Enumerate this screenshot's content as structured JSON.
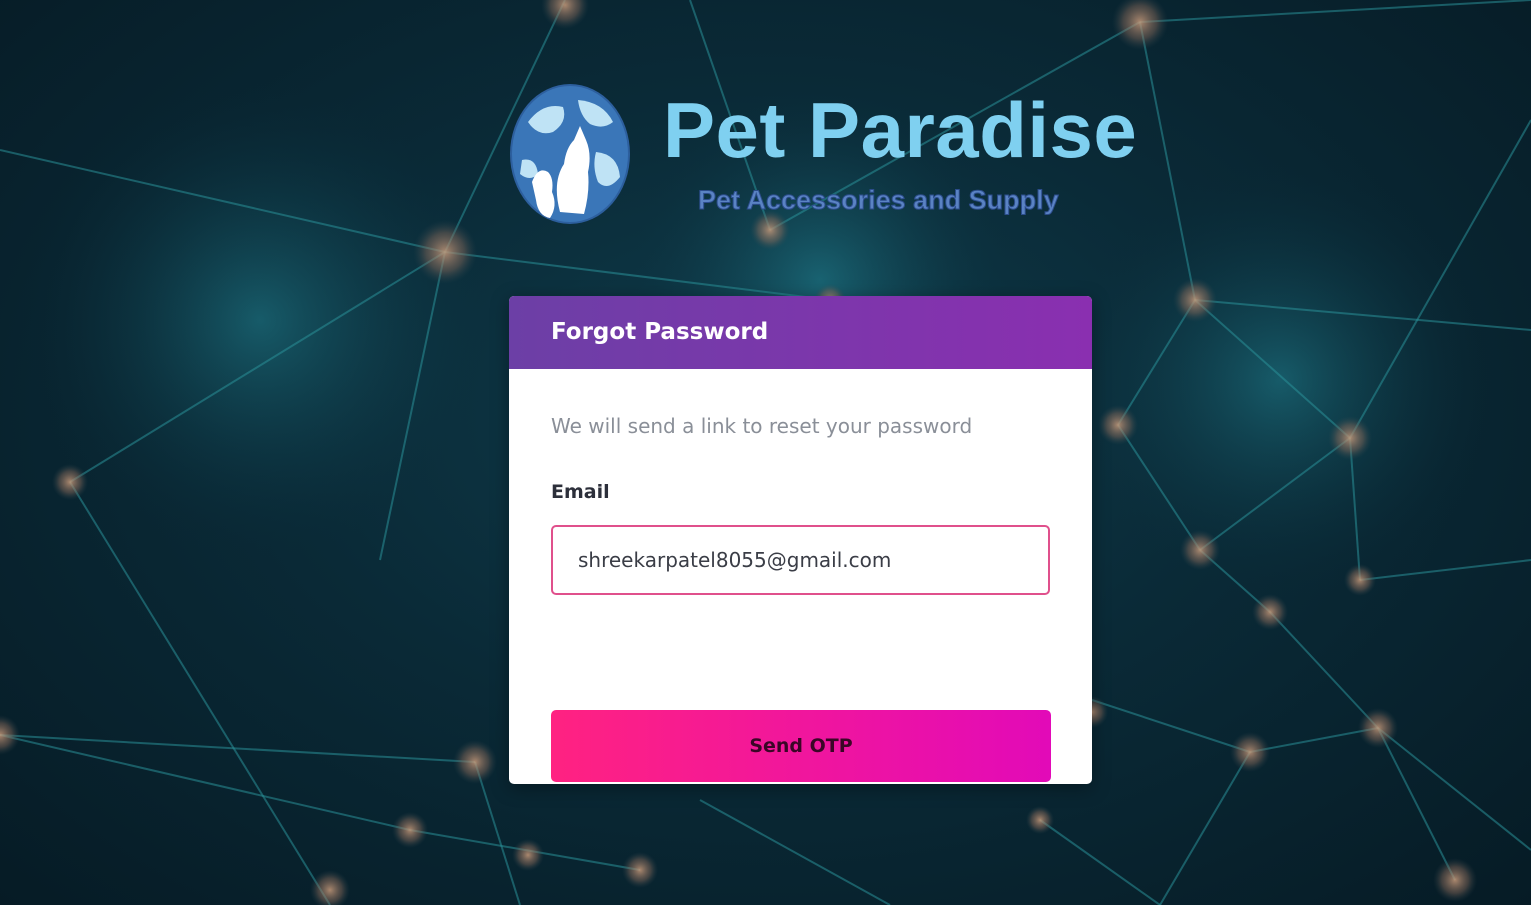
{
  "brand": {
    "name": "Pet Paradise",
    "tagline": "Pet Accessories and Supply",
    "logo_icon": "globe-with-cat-and-dog-logo"
  },
  "form": {
    "title": "Forgot Password",
    "description": "We will send a link to reset your password",
    "email_label": "Email",
    "email_value": "shreekarpatel8055@gmail.com",
    "submit_label": "Send OTP"
  },
  "colors": {
    "header_gradient_start": "#6c3fa6",
    "header_gradient_end": "#8a2fb0",
    "button_gradient_start": "#ff2281",
    "button_gradient_end": "#e20ab8",
    "input_border": "#e0508c",
    "brand_title": "#7fd0f0",
    "brand_tagline": "#5a83c4"
  }
}
